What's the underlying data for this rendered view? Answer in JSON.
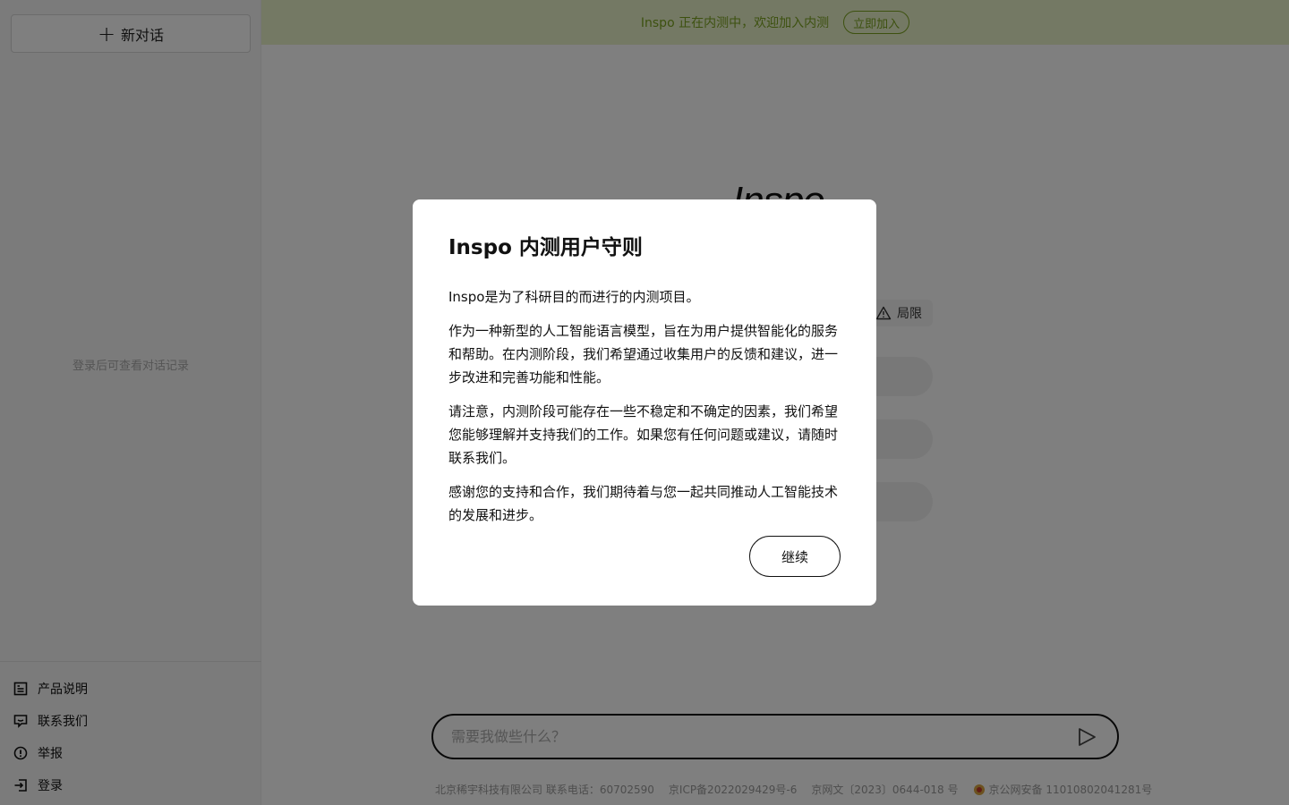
{
  "sidebar": {
    "new_chat_label": "新对话",
    "history_hint": "登录后可查看对话记录",
    "menu": [
      {
        "label": "产品说明",
        "icon": "document-icon"
      },
      {
        "label": "联系我们",
        "icon": "chat-icon"
      },
      {
        "label": "举报",
        "icon": "alert-circle-icon"
      },
      {
        "label": "登录",
        "icon": "login-icon"
      }
    ]
  },
  "banner": {
    "text": "Inspo 正在内测中，欢迎加入内测",
    "button": "立即加入"
  },
  "main": {
    "logo": "Inspo",
    "limit_chip": "局限",
    "input_placeholder": "需要我做些什么？"
  },
  "footer": {
    "company": "北京稀宇科技有限公司 联系电话：60702590",
    "icp": "京ICP备2022029429号-6",
    "netculture": "京网文〔2023〕0644-018 号",
    "police": "京公网安备 11010802041281号"
  },
  "modal": {
    "title": "Inspo 内测用户守则",
    "paragraphs": [
      "Inspo是为了科研目的而进行的内测项目。",
      "作为一种新型的人工智能语言模型，旨在为用户提供智能化的服务和帮助。在内测阶段，我们希望通过收集用户的反馈和建议，进一步改进和完善功能和性能。",
      "请注意，内测阶段可能存在一些不稳定和不确定的因素，我们希望您能够理解并支持我们的工作。如果您有任何问题或建议，请随时联系我们。",
      "感谢您的支持和合作，我们期待着与您一起共同推动人工智能技术的发展和进步。"
    ],
    "continue_button": "继续"
  },
  "colors": {
    "accent": "#7aa21f",
    "banner_bg": "#e8f3c9",
    "overlay": "rgba(0,0,0,0.5)"
  }
}
